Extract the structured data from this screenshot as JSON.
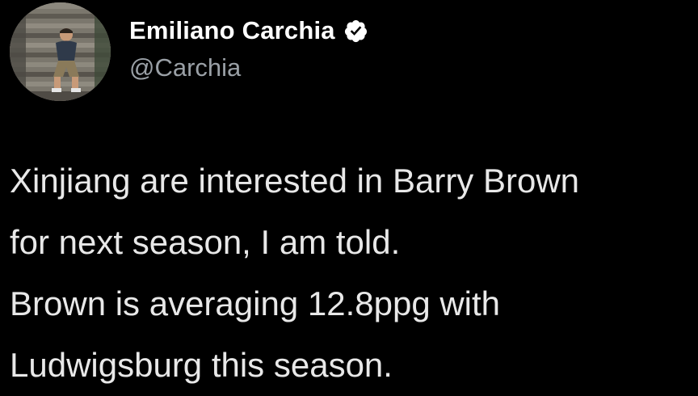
{
  "author": {
    "display_name": "Emiliano Carchia",
    "handle": "@Carchia",
    "verified": true,
    "verified_icon": "verified-badge-icon",
    "avatar_icon": "profile-photo"
  },
  "tweet": {
    "lines": [
      "Xinjiang are interested in Barry Brown",
      "for next season, I am told.",
      "Brown is averaging 12.8ppg with",
      "Ludwigsburg this season."
    ]
  },
  "colors": {
    "background": "#000000",
    "name": "#ffffff",
    "handle": "#9aa0a6",
    "body_text": "#e8e8e8"
  }
}
